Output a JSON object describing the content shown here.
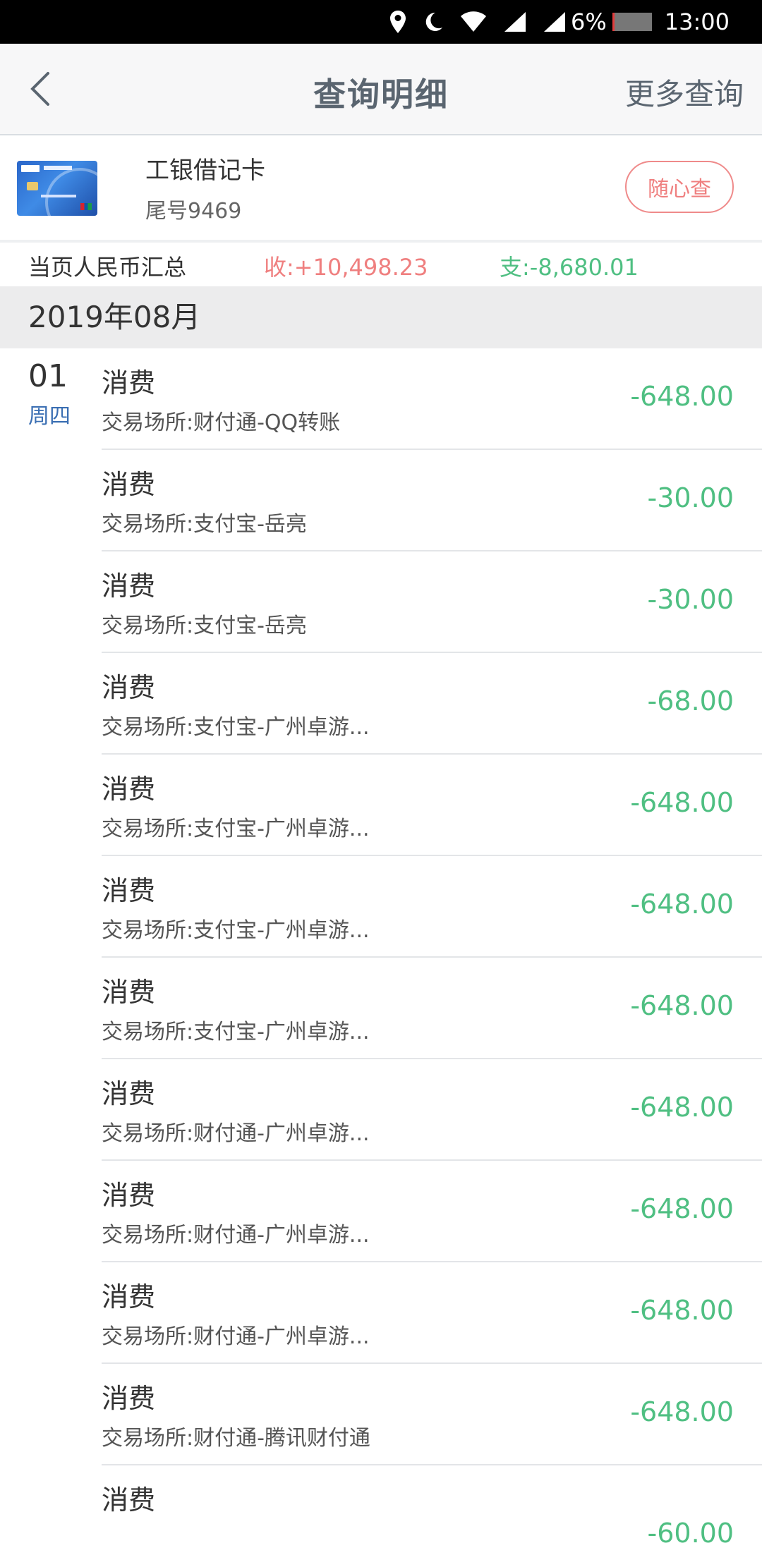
{
  "status_bar": {
    "battery": "6%",
    "battery_level": 0.06,
    "time": "13:00",
    "icons": [
      "location-icon",
      "moon-icon",
      "wifi-icon",
      "signal-icon",
      "signal-icon"
    ],
    "battery_color": "#e23b3b"
  },
  "header": {
    "title": "查询明细",
    "more_label": "更多查询",
    "back_icon": "chevron-left-icon"
  },
  "card": {
    "name": "工银借记卡",
    "tail": "尾号9469",
    "query_button": "随心查"
  },
  "summary": {
    "label": "当页人民币汇总",
    "income": "收:+10,498.23",
    "expense": "支:-8,680.01",
    "income_color": "#ef7f7f",
    "expense_color": "#4fbf82"
  },
  "month": "2019年08月",
  "day": {
    "date": "01",
    "weekday": "周四"
  },
  "transactions": [
    {
      "type": "消费",
      "desc": "交易场所:财付通-QQ转账",
      "amount": "-648.00"
    },
    {
      "type": "消费",
      "desc": "交易场所:支付宝-岳亮",
      "amount": "-30.00"
    },
    {
      "type": "消费",
      "desc": "交易场所:支付宝-岳亮",
      "amount": "-30.00"
    },
    {
      "type": "消费",
      "desc": "交易场所:支付宝-广州卓游...",
      "amount": "-68.00"
    },
    {
      "type": "消费",
      "desc": "交易场所:支付宝-广州卓游...",
      "amount": "-648.00"
    },
    {
      "type": "消费",
      "desc": "交易场所:支付宝-广州卓游...",
      "amount": "-648.00"
    },
    {
      "type": "消费",
      "desc": "交易场所:支付宝-广州卓游...",
      "amount": "-648.00"
    },
    {
      "type": "消费",
      "desc": "交易场所:财付通-广州卓游...",
      "amount": "-648.00"
    },
    {
      "type": "消费",
      "desc": "交易场所:财付通-广州卓游...",
      "amount": "-648.00"
    },
    {
      "type": "消费",
      "desc": "交易场所:财付通-广州卓游...",
      "amount": "-648.00"
    },
    {
      "type": "消费",
      "desc": "交易场所:财付通-腾讯财付通",
      "amount": "-648.00"
    },
    {
      "type": "消费",
      "desc": "",
      "amount": "-60.00"
    }
  ]
}
